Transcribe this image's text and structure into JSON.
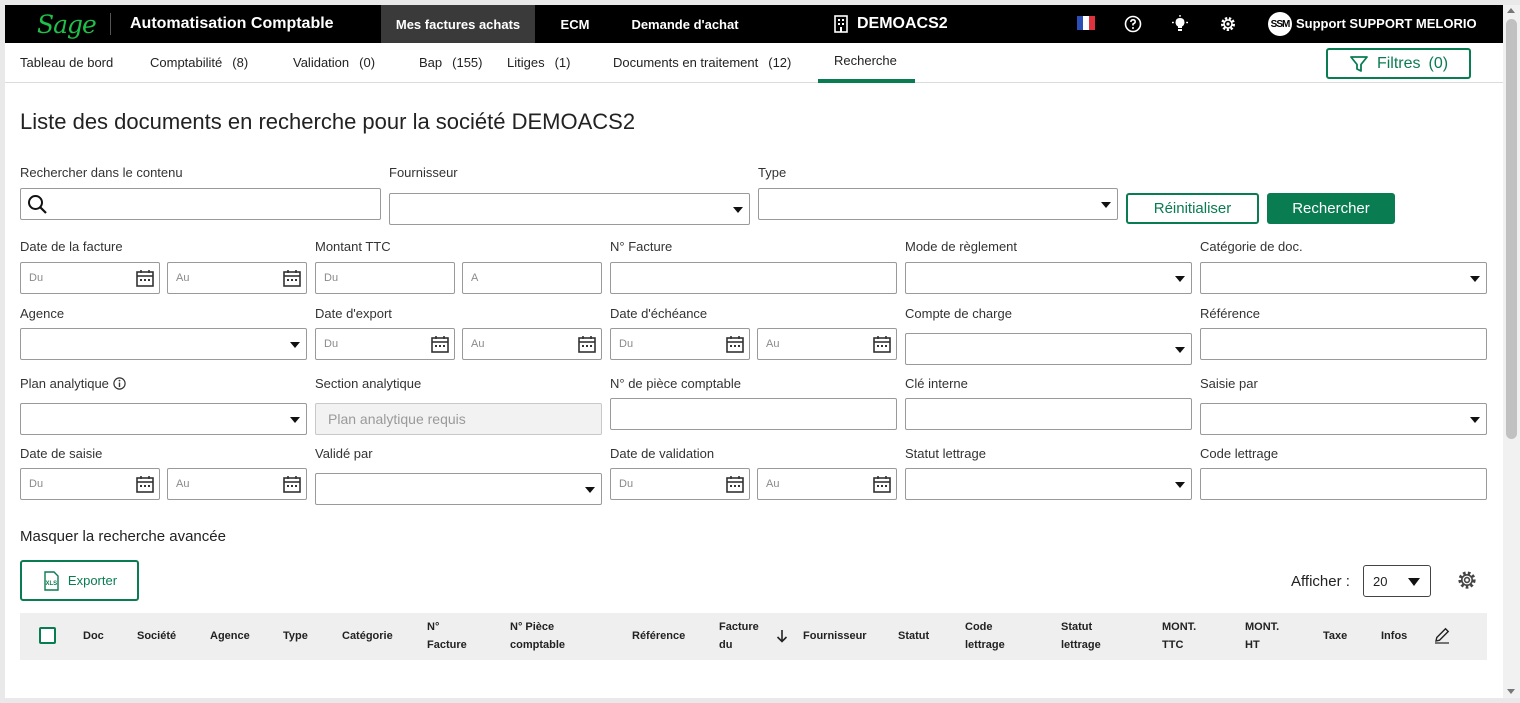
{
  "topbar": {
    "logo": "Sage",
    "app_title": "Automatisation Comptable",
    "nav": [
      "Mes factures achats",
      "ECM",
      "Demande d'achat"
    ],
    "company": "DEMOACS2",
    "avatar": "SSM",
    "user": "Support SUPPORT MELORIO",
    "icons": [
      "building-icon",
      "flag-fr-icon",
      "help-icon",
      "lightbulb-icon",
      "gear-icon"
    ]
  },
  "tabs": [
    {
      "label": "Tableau de bord",
      "count": ""
    },
    {
      "label": "Comptabilité",
      "count": "(8)"
    },
    {
      "label": "Validation",
      "count": "(0)"
    },
    {
      "label": "Bap",
      "count": "(155)"
    },
    {
      "label": "Litiges",
      "count": "(1)"
    },
    {
      "label": "Documents en traitement",
      "count": "(12)"
    },
    {
      "label": "Recherche",
      "count": ""
    }
  ],
  "filters_button": {
    "label": "Filtres",
    "count": "(0)"
  },
  "page_title": "Liste des documents en recherche pour la société DEMOACS2",
  "search": {
    "content_label": "Rechercher dans le contenu",
    "supplier_label": "Fournisseur",
    "type_label": "Type",
    "reset_label": "Réinitialiser",
    "search_label": "Rechercher"
  },
  "fields": {
    "invoice_date": "Date de la facture",
    "amount_ttc": "Montant TTC",
    "invoice_no": "N° Facture",
    "payment_mode": "Mode de règlement",
    "doc_category": "Catégorie de doc.",
    "agency": "Agence",
    "export_date": "Date d'export",
    "due_date": "Date d'échéance",
    "charge_account": "Compte de charge",
    "reference": "Référence",
    "analytic_plan": "Plan analytique",
    "analytic_section": "Section analytique",
    "accounting_piece": "N° de pièce comptable",
    "internal_key": "Clé interne",
    "entered_by": "Saisie par",
    "entry_date": "Date de saisie",
    "validated_by": "Validé par",
    "validation_date": "Date de validation",
    "lettering_status": "Statut lettrage",
    "lettering_code": "Code lettrage"
  },
  "placeholders": {
    "from": "Du",
    "to": "Au",
    "amount_to": "A",
    "analytic_section": "Plan analytique requis"
  },
  "advanced_toggle": "Masquer la recherche avancée",
  "export_button": "Exporter",
  "export_icon_text": "XLS",
  "afficher_label": "Afficher :",
  "page_size": "20",
  "table": {
    "columns": [
      [
        "Doc"
      ],
      [
        "Société"
      ],
      [
        "Agence"
      ],
      [
        "Type"
      ],
      [
        "Catégorie"
      ],
      [
        "N°",
        "Facture"
      ],
      [
        "N° Pièce",
        "comptable"
      ],
      [
        "Référence"
      ],
      [
        "Facture",
        "du"
      ],
      [
        "Fournisseur"
      ],
      [
        "Statut"
      ],
      [
        "Code",
        "lettrage"
      ],
      [
        "Statut",
        "lettrage"
      ],
      [
        "MONT.",
        "TTC"
      ],
      [
        "MONT.",
        "HT"
      ],
      [
        "Taxe"
      ],
      [
        "Infos"
      ]
    ]
  },
  "colors": {
    "accent": "#0a7c52",
    "brand_green": "#1ec04a",
    "topbar": "#000000"
  }
}
